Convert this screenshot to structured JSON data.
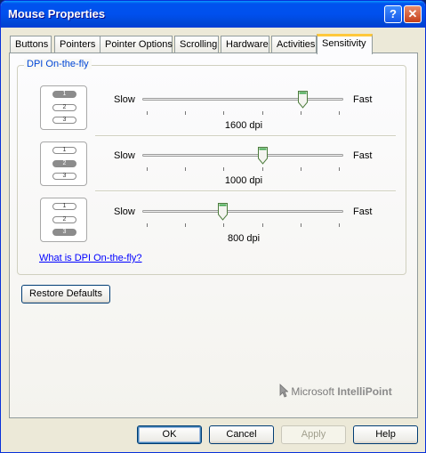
{
  "window": {
    "title": "Mouse Properties"
  },
  "tabs": [
    "Buttons",
    "Pointers",
    "Pointer Options",
    "Scrolling",
    "Hardware",
    "Activities",
    "Sensitivity"
  ],
  "active_tab": "Sensitivity",
  "group": {
    "label": "DPI On-the-fly"
  },
  "sliders": [
    {
      "slow": "Slow",
      "fast": "Fast",
      "value_label": "1600 dpi",
      "position": 0.8,
      "active_button": 1
    },
    {
      "slow": "Slow",
      "fast": "Fast",
      "value_label": "1000 dpi",
      "position": 0.6,
      "active_button": 2
    },
    {
      "slow": "Slow",
      "fast": "Fast",
      "value_label": "800 dpi",
      "position": 0.4,
      "active_button": 3
    }
  ],
  "button_numbers": [
    "1",
    "2",
    "3"
  ],
  "link_text": "What is DPI On-the-fly?",
  "restore_label": "Restore Defaults",
  "brand": {
    "company": "Microsoft",
    "product": "IntelliPoint"
  },
  "footer": {
    "ok": "OK",
    "cancel": "Cancel",
    "apply": "Apply",
    "help": "Help"
  },
  "icons": [
    "help-icon",
    "close-icon",
    "mouse-icon",
    "slider-thumb-icon",
    "pointer-logo-icon"
  ],
  "colors": {
    "titlebar": "#0050ee",
    "link": "#0000ff",
    "group_label": "#0046d5",
    "active_tab_accent": "#ffc83c"
  }
}
